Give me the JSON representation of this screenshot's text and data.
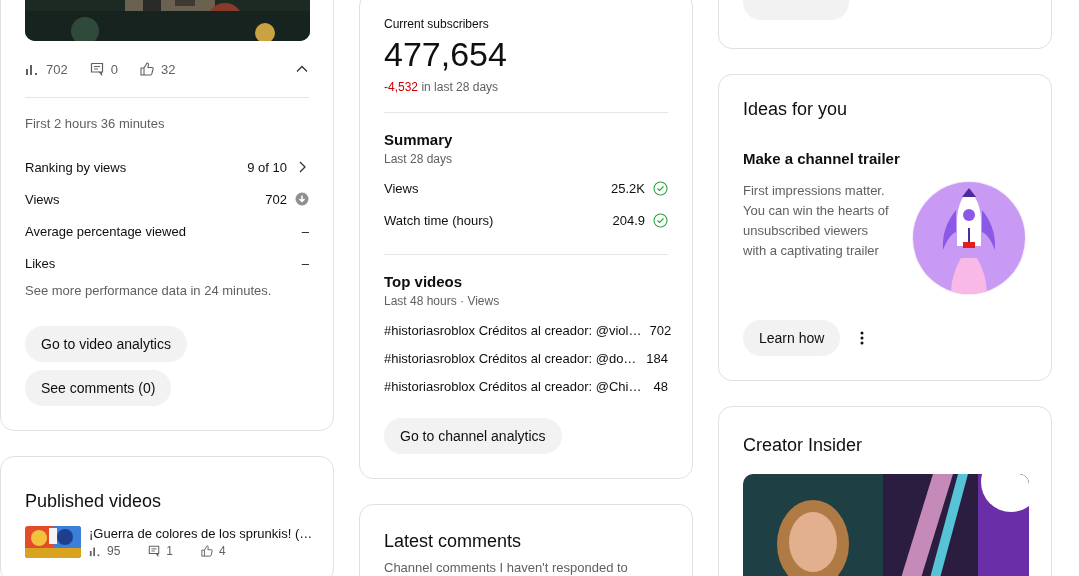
{
  "recent_video": {
    "stats": [
      {
        "kind": "views",
        "value": "702"
      },
      {
        "kind": "comments",
        "value": "0"
      },
      {
        "kind": "likes",
        "value": "32"
      }
    ],
    "expanded": true,
    "period": "First 2 hours 36 minutes",
    "metrics": [
      {
        "label": "Ranking by views",
        "value": "9 of 10",
        "kind": "link"
      },
      {
        "label": "Views",
        "value": "702",
        "kind": "below"
      },
      {
        "label": "Average percentage viewed",
        "value": "–",
        "kind": "plain"
      },
      {
        "label": "Likes",
        "value": "–",
        "kind": "plain"
      }
    ],
    "note": "See more performance data in 24 minutes.",
    "buttons": [
      "Go to video analytics",
      "See comments (0)"
    ]
  },
  "published_videos": {
    "title": "Published videos",
    "videos": [
      {
        "title": "¡Guerra de colores de los sprunkis! (…",
        "views": "95",
        "comments": "1",
        "likes": "4"
      }
    ]
  },
  "channel_analytics": {
    "subscribers_label": "Current subscribers",
    "subscribers": "477,654",
    "change": "-4,532",
    "negative": true,
    "change_suffix": "in last 28 days",
    "summary": {
      "title": "Summary",
      "period": "Last 28 days",
      "rows": [
        {
          "label": "Views",
          "value": "25.2K",
          "goal_met": true
        },
        {
          "label": "Watch time (hours)",
          "value": "204.9",
          "goal_met": true
        }
      ]
    },
    "top_videos": {
      "title": "Top videos",
      "period": "Last 48 hours · Views",
      "rows": [
        {
          "title": "#historiasroblox Créditos al creador: @viol…",
          "views": "702"
        },
        {
          "title": "#historiasroblox Créditos al creador: @do…",
          "views": "184"
        },
        {
          "title": "#historiasroblox Créditos al creador: @Chi…",
          "views": "48"
        }
      ]
    },
    "button": "Go to channel analytics"
  },
  "latest_comments": {
    "title": "Latest comments",
    "subtitle": "Channel comments I haven't responded to"
  },
  "ideas": {
    "title": "Ideas for you",
    "idea_title": "Make a channel trailer",
    "body": "First impressions matter. You can win the hearts of unsubscribed viewers with a captivating trailer",
    "button": "Learn how"
  },
  "creator_insider": {
    "title": "Creator Insider"
  }
}
